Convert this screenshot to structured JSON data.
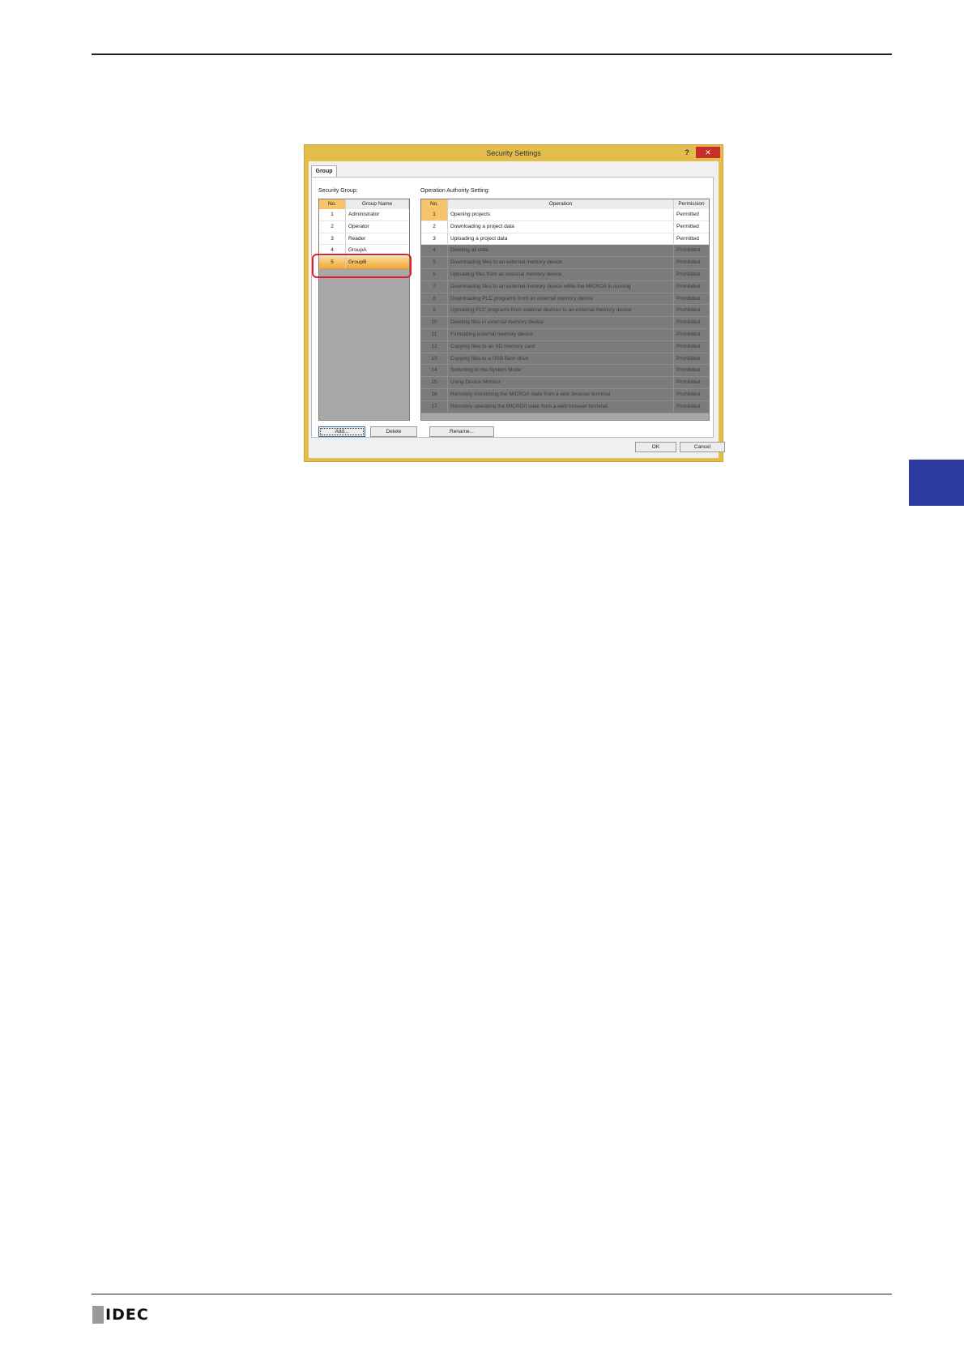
{
  "dialog": {
    "title": "Security Settings",
    "help_label": "?",
    "close_label": "✕",
    "tab_label": "Group",
    "security_group_label": "Security Group:",
    "operation_authority_label": "Operation Authority Setting:",
    "groups": {
      "headers": [
        "No.",
        "Group Name"
      ],
      "rows": [
        {
          "no": "1",
          "name": "Administrator"
        },
        {
          "no": "2",
          "name": "Operator"
        },
        {
          "no": "3",
          "name": "Reader"
        },
        {
          "no": "4",
          "name": "GroupA"
        },
        {
          "no": "5",
          "name": "GroupB"
        }
      ],
      "selected_index": 4
    },
    "operations": {
      "headers": [
        "No.",
        "Operation",
        "Permission"
      ],
      "rows": [
        {
          "no": "1",
          "operation": "Opening projects",
          "permission": "Permitted"
        },
        {
          "no": "2",
          "operation": "Downloading a project data",
          "permission": "Permitted"
        },
        {
          "no": "3",
          "operation": "Uploading a project data",
          "permission": "Permitted"
        },
        {
          "no": "4",
          "operation": "Deleting all data",
          "permission": "Prohibited"
        },
        {
          "no": "5",
          "operation": "Downloading files to an external memory device",
          "permission": "Prohibited"
        },
        {
          "no": "6",
          "operation": "Uploading files from an external memory device",
          "permission": "Prohibited"
        },
        {
          "no": "7",
          "operation": "Downloading files to an external memory device while the MICRO/I is running",
          "permission": "Prohibited"
        },
        {
          "no": "8",
          "operation": "Downloading PLC programs from an external memory device",
          "permission": "Prohibited"
        },
        {
          "no": "9",
          "operation": "Uploading PLC programs from external devices to an external memory device",
          "permission": "Prohibited"
        },
        {
          "no": "10",
          "operation": "Deleting files in external memory device",
          "permission": "Prohibited"
        },
        {
          "no": "11",
          "operation": "Formatting external memory device",
          "permission": "Prohibited"
        },
        {
          "no": "12",
          "operation": "Copying files to an SD memory card",
          "permission": "Prohibited"
        },
        {
          "no": "13",
          "operation": "Copying files to a USB flash drive",
          "permission": "Prohibited"
        },
        {
          "no": "14",
          "operation": "Switching to the System Mode",
          "permission": "Prohibited"
        },
        {
          "no": "15",
          "operation": "Using Device Monitor",
          "permission": "Prohibited"
        },
        {
          "no": "16",
          "operation": "Remotely monitoring the MICRO/I state from a web browser terminal",
          "permission": "Prohibited"
        },
        {
          "no": "17",
          "operation": "Remotely operating the MICRO/I state from a web browser terminal",
          "permission": "Prohibited"
        }
      ]
    },
    "buttons": {
      "add": "Add...",
      "delete": "Delete",
      "rename": "Rename...",
      "ok": "OK",
      "cancel": "Cancel"
    }
  },
  "footer": {
    "logo_text": "IDEC"
  },
  "colors": {
    "dialog_frame": "#e3bd4c",
    "selection": "#f3a83e",
    "highlight_box": "#e0202a",
    "side_tab": "#2b3a9e"
  }
}
